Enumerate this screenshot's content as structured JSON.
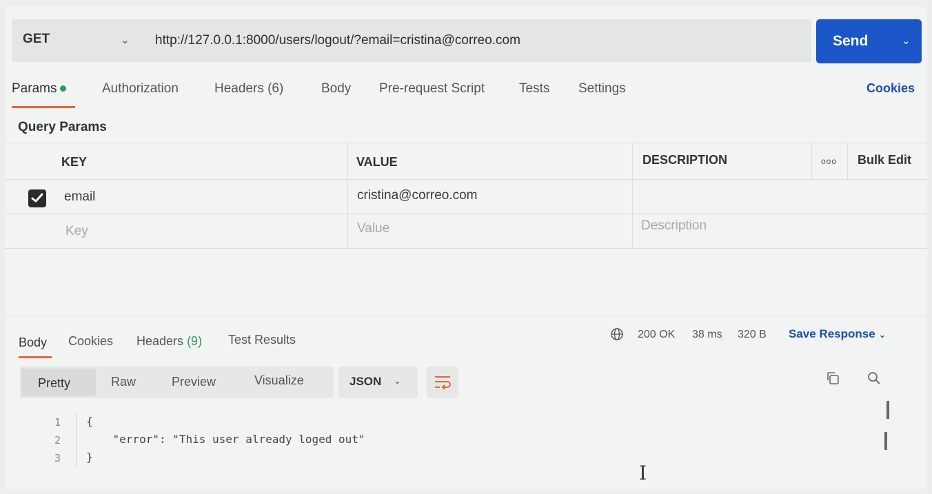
{
  "request": {
    "method": "GET",
    "url": "http://127.0.0.1:8000/users/logout/?email=cristina@correo.com",
    "send_label": "Send"
  },
  "request_tabs": {
    "params": "Params",
    "authorization": "Authorization",
    "headers": "Headers (6)",
    "body": "Body",
    "pre_request_script": "Pre-request Script",
    "tests": "Tests",
    "settings": "Settings",
    "cookies": "Cookies"
  },
  "query_params": {
    "title": "Query Params",
    "columns": {
      "key": "KEY",
      "value": "VALUE",
      "description": "DESCRIPTION",
      "more": "ooo",
      "bulk_edit": "Bulk Edit"
    },
    "rows": [
      {
        "checked": true,
        "key": "email",
        "value": "cristina@correo.com",
        "description": ""
      }
    ],
    "placeholders": {
      "key": "Key",
      "value": "Value",
      "description": "Description"
    }
  },
  "response_tabs": {
    "body": "Body",
    "cookies": "Cookies",
    "headers_prefix": "Headers",
    "headers_count": "(9)",
    "test_results": "Test Results"
  },
  "response_status": {
    "status": "200 OK",
    "time": "38 ms",
    "size": "320 B",
    "save_response": "Save Response"
  },
  "format_bar": {
    "pretty": "Pretty",
    "raw": "Raw",
    "preview": "Preview",
    "visualize": "Visualize",
    "language": "JSON"
  },
  "code": {
    "line_numbers": [
      "1",
      "2",
      "3"
    ],
    "lines": [
      "{",
      "    \"error\": \"This user already loged out\"",
      "}"
    ]
  },
  "colors": {
    "send_button": "#1a56c8",
    "active_tab_underline": "#e0683d",
    "params_dot": "#2f9b5c",
    "link": "#1f4faa"
  }
}
